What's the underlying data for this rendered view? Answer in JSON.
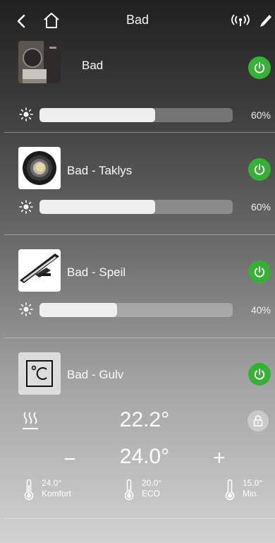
{
  "header": {
    "title": "Bad",
    "back_icon": "chevron-left-icon",
    "home_icon": "home-icon",
    "signal_icon": "wifi-signal-icon",
    "edit_icon": "pencil-icon"
  },
  "colors": {
    "power_on": "#34b233",
    "slider_fill": "#efefef"
  },
  "rooms": [
    {
      "name": "Bad",
      "thumb_icon": "bathroom-photo",
      "brightness_label": "60%",
      "brightness_level": 0.6
    },
    {
      "name": "Bad - Taklys",
      "thumb_icon": "ceiling-spotlight-icon",
      "brightness_label": "60%",
      "brightness_level": 0.6
    },
    {
      "name": "Bad - Speil",
      "thumb_icon": "mirror-light-icon",
      "brightness_label": "40%",
      "brightness_level": 0.4
    },
    {
      "name": "Bad - Gulv",
      "thumb_icon": "thermostat-icon"
    }
  ],
  "thermostat": {
    "current_temp": "22.2°",
    "setpoint": "24.0°",
    "minus_label": "−",
    "plus_label": "+",
    "presets": [
      {
        "value": "24.0°",
        "label": "Komfort"
      },
      {
        "value": "20.0°",
        "label": "ECO"
      },
      {
        "value": "15.0°",
        "label": "Min."
      }
    ]
  }
}
